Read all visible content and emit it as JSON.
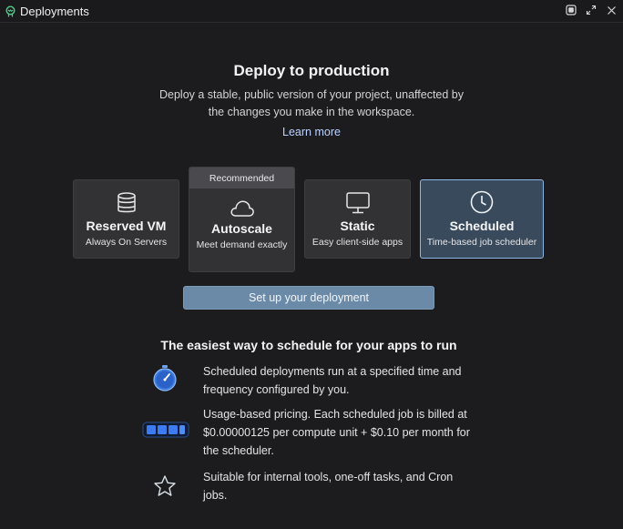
{
  "window": {
    "title": "Deployments"
  },
  "hero": {
    "heading": "Deploy to production",
    "subtext": "Deploy a stable, public version of your project, unaffected by the changes you make in the workspace.",
    "learn_more": "Learn more"
  },
  "cards": {
    "reserved": {
      "title": "Reserved VM",
      "subtitle": "Always On Servers",
      "icon": "database-icon"
    },
    "autoscale": {
      "banner": "Recommended",
      "title": "Autoscale",
      "subtitle": "Meet demand exactly",
      "icon": "cloud-icon"
    },
    "static": {
      "title": "Static",
      "subtitle": "Easy client-side apps",
      "icon": "monitor-icon"
    },
    "scheduled": {
      "title": "Scheduled",
      "subtitle": "Time-based job scheduler",
      "icon": "clock-icon",
      "selected": true
    }
  },
  "setup_button": "Set up your deployment",
  "info": {
    "title": "The easiest way to schedule for your apps to run",
    "features": [
      {
        "icon": "stopwatch-icon",
        "text": "Scheduled deployments run at a specified time and frequency configured by you."
      },
      {
        "icon": "battery-icon",
        "text": "Usage-based pricing. Each scheduled job is billed at $0.00000125 per compute unit + $0.10 per month for the scheduler."
      },
      {
        "icon": "star-icon",
        "text": "Suitable for internal tools, one-off tasks, and Cron jobs."
      }
    ]
  },
  "colors": {
    "background": "#1c1c1e",
    "card": "#323234",
    "selected_card": "#394a5c",
    "selected_border": "#8fb6e6",
    "button": "#6b8aa8",
    "link": "#bcd2ff"
  }
}
